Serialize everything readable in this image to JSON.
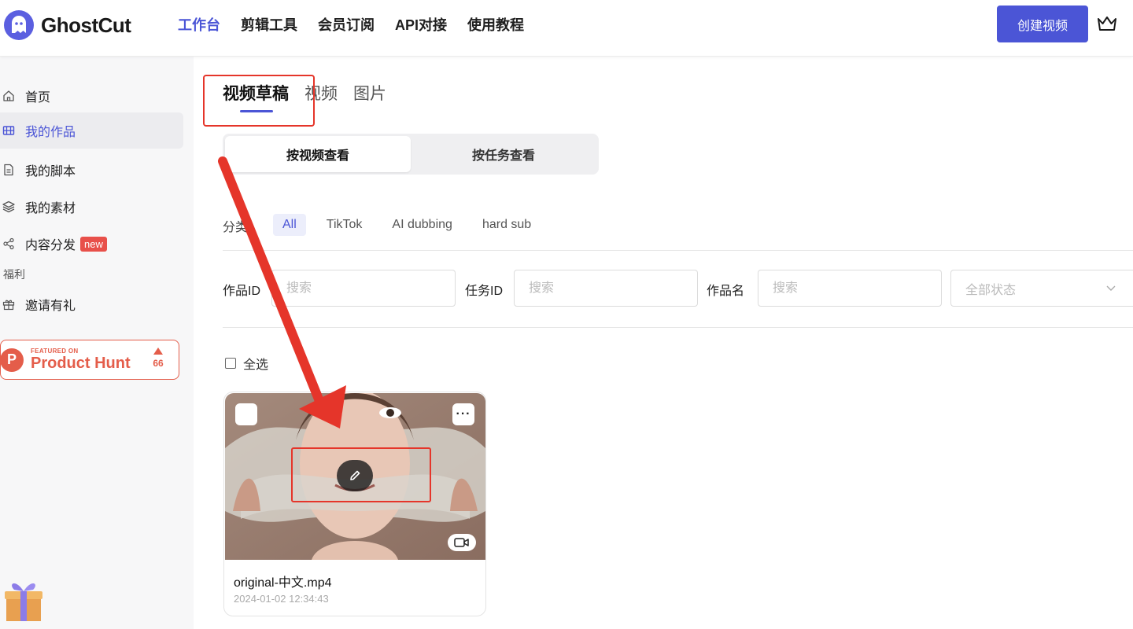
{
  "header": {
    "logo_text": "GhostCut",
    "nav": [
      "工作台",
      "剪辑工具",
      "会员订阅",
      "API对接",
      "使用教程"
    ],
    "create_button": "创建视频",
    "brand_color": "#4b55d6"
  },
  "sidebar": {
    "items": [
      {
        "label": "首页",
        "icon": "home-icon"
      },
      {
        "label": "我的作品",
        "icon": "film-icon"
      },
      {
        "label": "我的脚本",
        "icon": "document-icon"
      },
      {
        "label": "我的素材",
        "icon": "layers-icon"
      },
      {
        "label": "内容分发",
        "icon": "share-icon",
        "badge": "new"
      }
    ],
    "section_label": "福利",
    "invite_label": "邀请有礼",
    "producthunt": {
      "small": "FEATURED ON",
      "big": "Product Hunt",
      "count": "66"
    }
  },
  "main": {
    "tabs": [
      "视频草稿",
      "视频",
      "图片"
    ],
    "segments": [
      "按视频查看",
      "按任务查看"
    ],
    "category_label": "分类",
    "chips": [
      "All",
      "TikTok",
      "AI dubbing",
      "hard sub"
    ],
    "filters": {
      "work_id_label": "作品ID",
      "task_id_label": "任务ID",
      "work_name_label": "作品名",
      "placeholder": "搜索",
      "status_placeholder": "全部状态"
    },
    "select_all": "全选",
    "card": {
      "title": "original-中文.mp4",
      "date": "2024-01-02 12:34:43",
      "more": "···"
    }
  },
  "annotation_color": "#e5352a"
}
